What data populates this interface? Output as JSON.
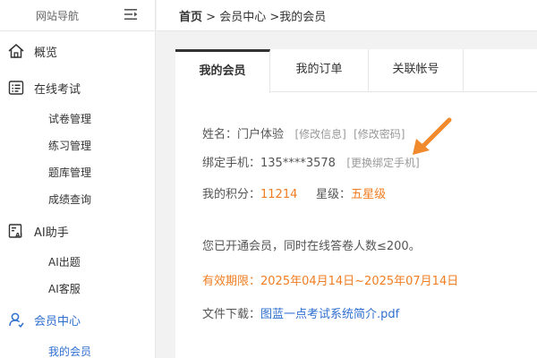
{
  "sidebar": {
    "title": "网站导航",
    "toggle_icon": "menu-toggle-icon",
    "groups": [
      {
        "label": "概览",
        "icon": "home-icon"
      },
      {
        "label": "在线考试",
        "icon": "exam-list-icon",
        "items": [
          "试卷管理",
          "练习管理",
          "题库管理",
          "成绩查询"
        ]
      },
      {
        "label": "AI助手",
        "icon": "ai-icon",
        "items": [
          "AI出题",
          "AI客服"
        ]
      },
      {
        "label": "会员中心",
        "icon": "user-icon",
        "items": [
          "我的会员"
        ]
      }
    ]
  },
  "breadcrumb": {
    "home": "首页",
    "sep1": " > ",
    "level1": "会员中心",
    "sep2": " >",
    "level2": "我的会员"
  },
  "tabs": [
    "我的会员",
    "我的订单",
    "关联帐号"
  ],
  "member": {
    "name_label": "姓名：",
    "name_value": "门户体验",
    "edit_info": "[修改信息]",
    "change_password": "[修改密码]",
    "phone_label": "绑定手机：",
    "phone_value": "135****3578",
    "change_phone": "[更换绑定手机]",
    "points_label": "我的积分：",
    "points_value": "11214",
    "level_label": "星级：",
    "level_value": "五星级",
    "notice": "您已开通会员，同时在线答卷人数≤200。",
    "validity": "有效期限：2025年04月14日~2025年07月14日",
    "download_label": "文件下载：",
    "download_link": "图蓝一点考试系统简介.pdf"
  },
  "colors": {
    "accent": "#f07d22",
    "link": "#2f6fd0",
    "sidebar_active": "#2f6fd0"
  }
}
